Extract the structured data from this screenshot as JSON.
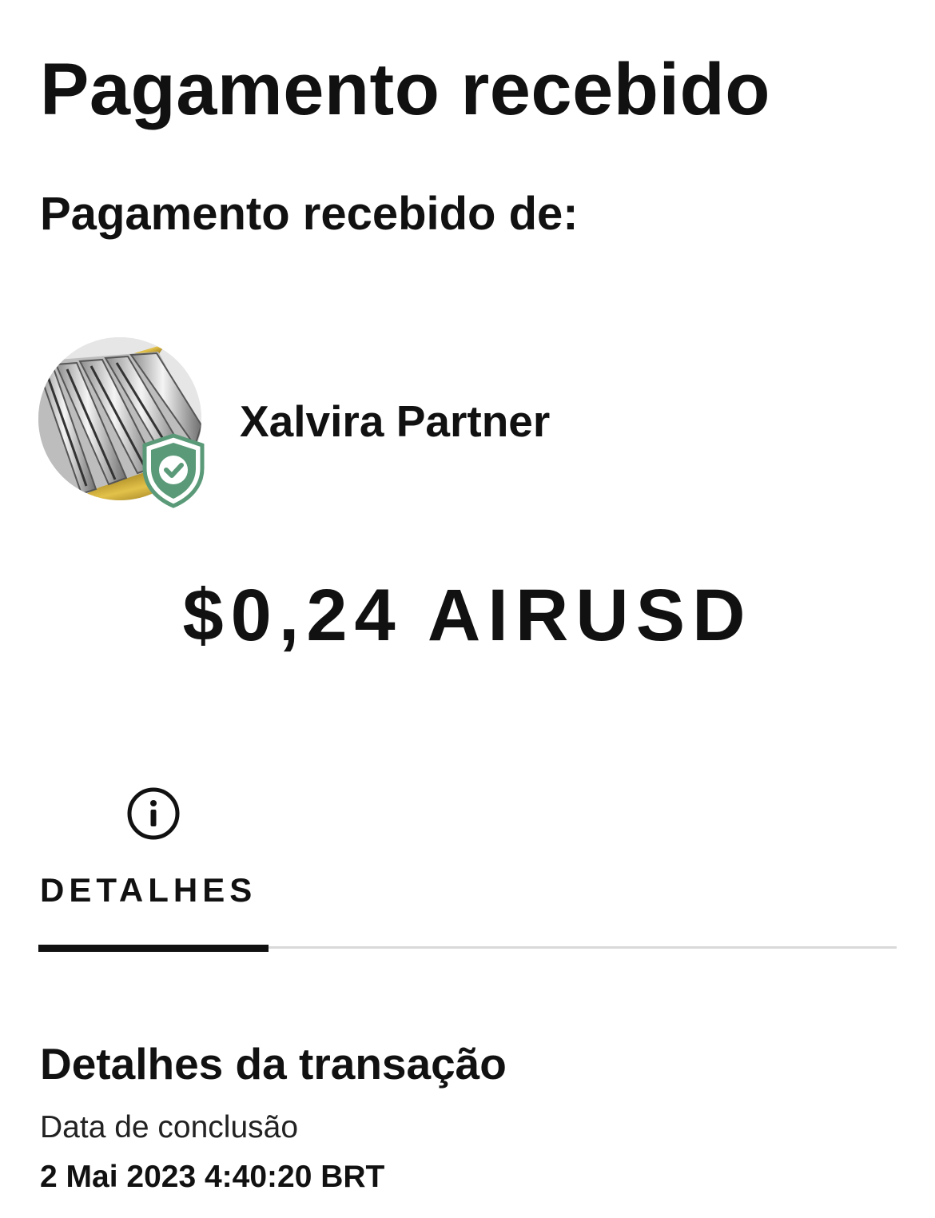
{
  "header": {
    "title": "Pagamento recebido"
  },
  "payment": {
    "from_label": "Pagamento recebido de:",
    "sender_name": "Xalvira Partner",
    "amount": "$0,24 AIRUSD"
  },
  "icons": {
    "avatar": "metallic-bars-avatar",
    "badge": "verified-shield-icon",
    "tab": "info-icon"
  },
  "tabs": [
    {
      "label": "DETALHES",
      "active": true
    }
  ],
  "details": {
    "section_title": "Detalhes da transação",
    "completion_date_label": "Data de conclusão",
    "completion_date_value": "2 Mai 2023 4:40:20 BRT"
  },
  "colors": {
    "text": "#111111",
    "badge_green": "#5a9a78",
    "tab_track": "#d9d9d9"
  }
}
